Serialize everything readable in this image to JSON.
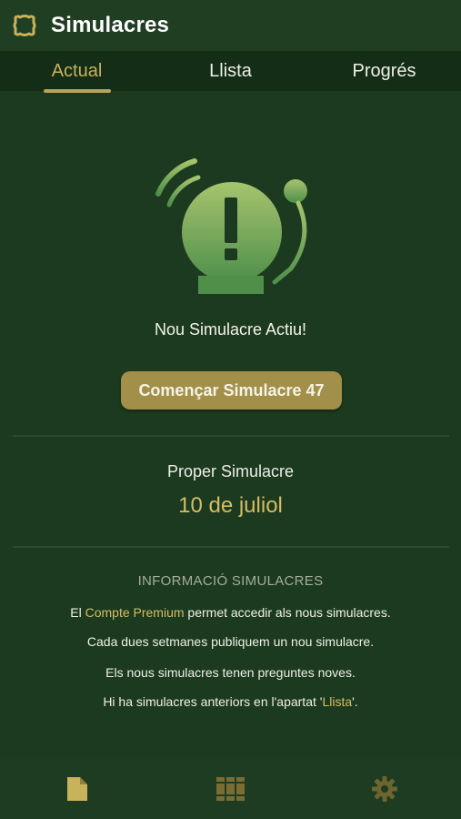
{
  "app": {
    "title": "Simulacres"
  },
  "tabs": [
    {
      "label": "Actual",
      "active": true
    },
    {
      "label": "Llista",
      "active": false
    },
    {
      "label": "Progrés",
      "active": false
    }
  ],
  "current": {
    "active_text": "Nou Simulacre Actiu!",
    "start_button": "Començar Simulacre 47",
    "next_label": "Proper Simulacre",
    "next_date": "10 de juliol"
  },
  "info": {
    "title": "INFORMACIÓ SIMULACRES",
    "line1_pre": "El ",
    "line1_link": "Compte Premium",
    "line1_post": " permet accedir als nous simulacres.",
    "line2": "Cada dues setmanes publiquem un nou simulacre.",
    "line3": "Els nous simulacres tenen preguntes noves.",
    "line4_pre": "Hi ha simulacres anteriors en l'apartat '",
    "line4_link": "Llista",
    "line4_post": "'."
  },
  "bottom_nav": [
    {
      "icon": "document-icon",
      "active": true
    },
    {
      "icon": "books-icon",
      "active": false
    },
    {
      "icon": "gear-icon",
      "active": false
    }
  ],
  "colors": {
    "background": "#1c3a1f",
    "accent": "#c8b25a",
    "button": "#a2904a",
    "bell_light": "#a6c46e",
    "bell_dark": "#4f8f4a"
  }
}
